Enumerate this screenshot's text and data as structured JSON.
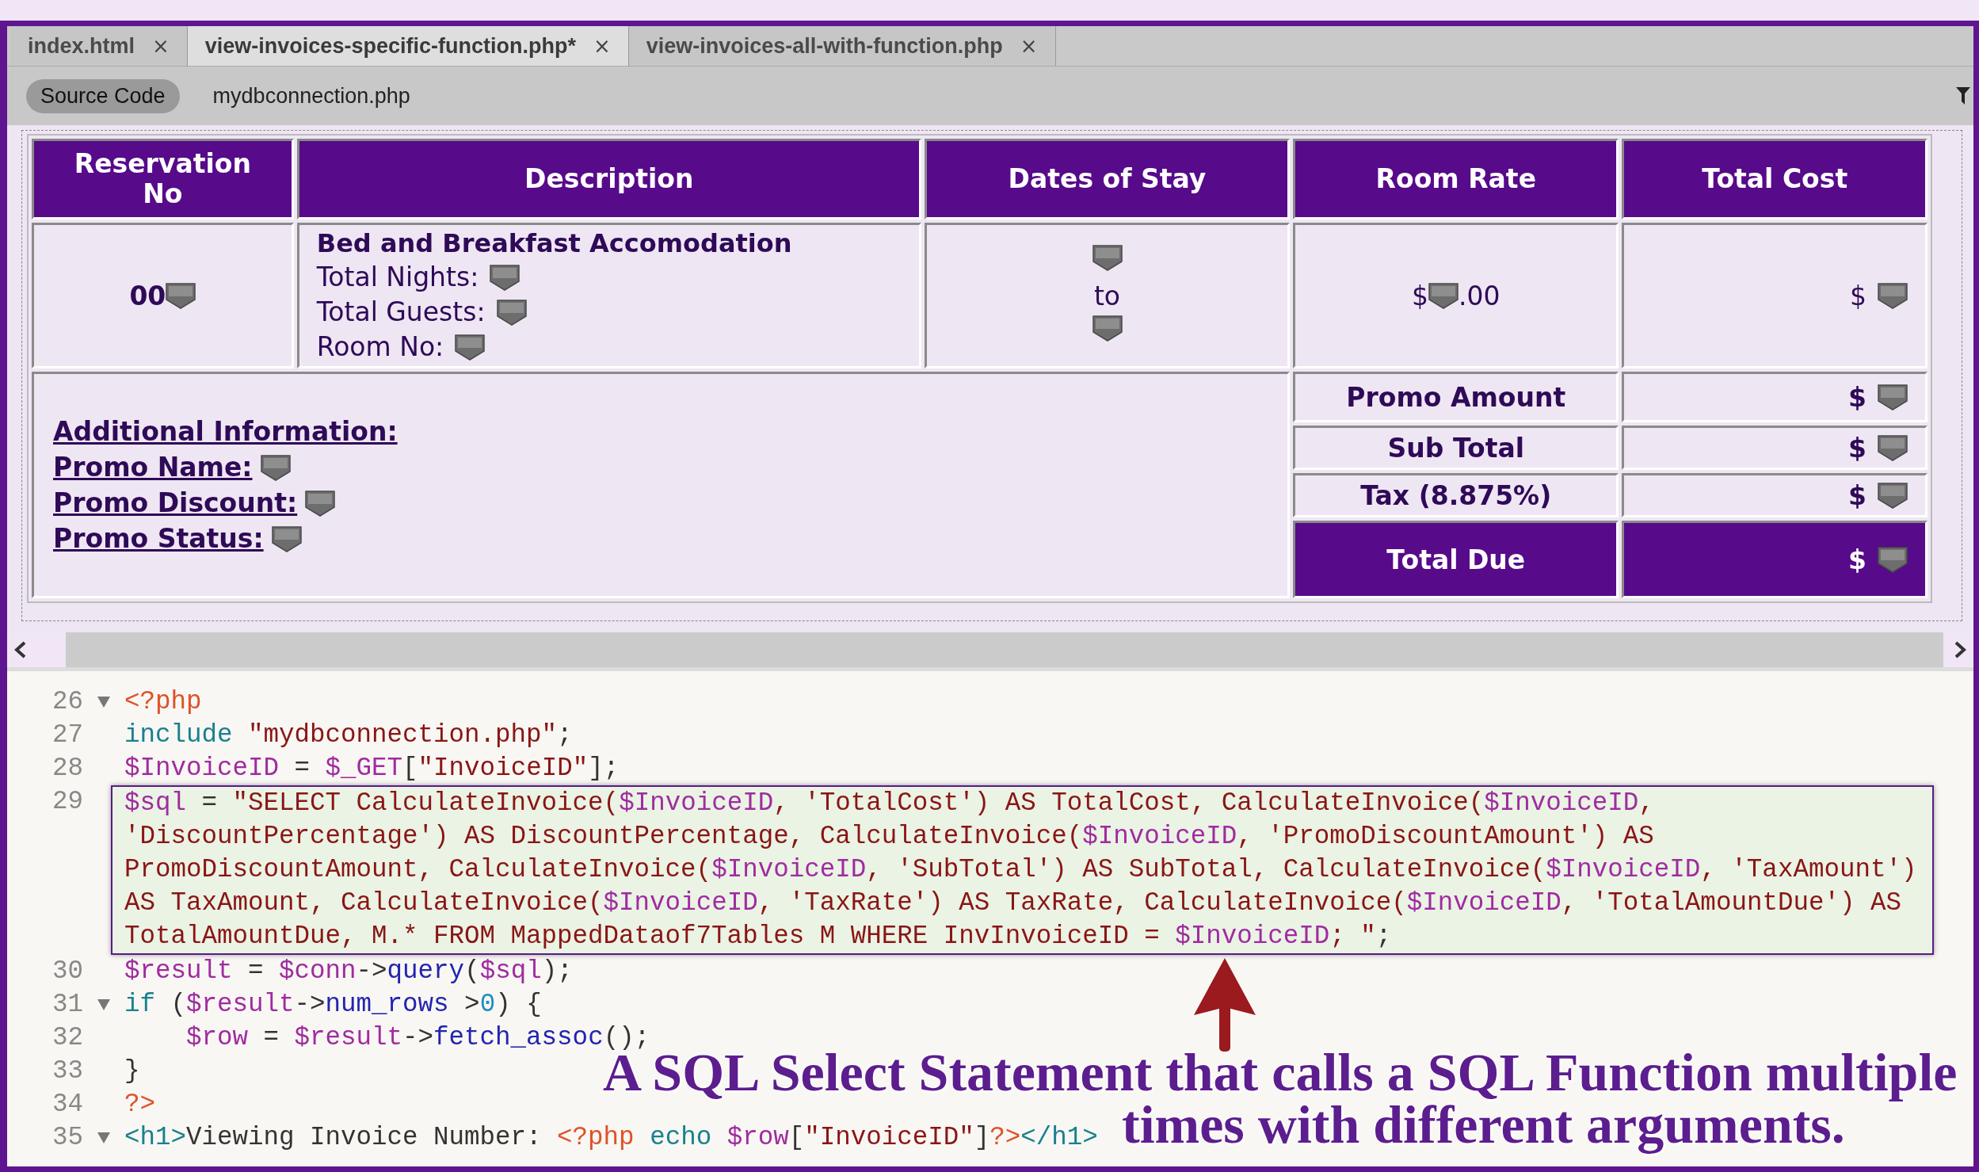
{
  "tabs": [
    {
      "label": "index.html",
      "close": "×",
      "selected": false
    },
    {
      "label": "view-invoices-specific-function.php*",
      "close": "×",
      "selected": true
    },
    {
      "label": "view-invoices-all-with-function.php",
      "close": "×",
      "selected": false
    }
  ],
  "related_files": [
    {
      "label": "Source Code",
      "selected": true
    },
    {
      "label": "mydbconnection.php",
      "selected": false
    }
  ],
  "invoice": {
    "columns": [
      "Reservation No",
      "Description",
      "Dates of Stay",
      "Room Rate",
      "Total Cost"
    ],
    "reservation_no": "00",
    "description_title": "Bed and Breakfast Accomodation",
    "description_lines": [
      "Total Nights:",
      "Total Guests:",
      "Room No:"
    ],
    "dates_separator": "to",
    "room_rate_prefix": "$",
    "room_rate_suffix": ".00",
    "total_cost_prefix": "$",
    "additional_heading": "Additional Information:",
    "additional_items": [
      "Promo Name:",
      "Promo Discount:",
      "Promo Status:"
    ],
    "summary": [
      {
        "label": "Promo Amount",
        "value": "$",
        "kind": "normal"
      },
      {
        "label": "Sub Total",
        "value": "$",
        "kind": "normal"
      },
      {
        "label": "Tax (8.875%)",
        "value": "$",
        "kind": "normal"
      },
      {
        "label": "Total Due",
        "value": "$",
        "kind": "total"
      }
    ]
  },
  "code": [
    {
      "number": "26",
      "foldable": true,
      "visual_lines": [
        {
          "tokens": [
            {
              "kind": "php",
              "text": "<?php"
            }
          ]
        }
      ]
    },
    {
      "number": "27",
      "foldable": false,
      "visual_lines": [
        {
          "tokens": [
            {
              "kind": "kw",
              "text": "include "
            },
            {
              "kind": "str",
              "text": "\"mydbconnection.php\""
            },
            {
              "kind": "plain",
              "text": ";"
            }
          ]
        }
      ]
    },
    {
      "number": "28",
      "foldable": false,
      "visual_lines": [
        {
          "tokens": [
            {
              "kind": "var",
              "text": "$InvoiceID"
            },
            {
              "kind": "plain",
              "text": " = "
            },
            {
              "kind": "var",
              "text": "$_GET"
            },
            {
              "kind": "plain",
              "text": "["
            },
            {
              "kind": "str",
              "text": "\"InvoiceID\""
            },
            {
              "kind": "plain",
              "text": "];"
            }
          ]
        }
      ]
    },
    {
      "number": "29",
      "foldable": false,
      "highlighted": true,
      "visual_lines": [
        {
          "tokens": [
            {
              "kind": "var",
              "text": "$sql"
            },
            {
              "kind": "plain",
              "text": " = "
            },
            {
              "kind": "str",
              "text": "\"SELECT CalculateInvoice("
            },
            {
              "kind": "var",
              "text": "$InvoiceID"
            },
            {
              "kind": "str",
              "text": ", 'TotalCost') AS TotalCost, CalculateInvoice("
            },
            {
              "kind": "var",
              "text": "$InvoiceID"
            },
            {
              "kind": "str",
              "text": ","
            }
          ]
        },
        {
          "tokens": [
            {
              "kind": "str",
              "text": "'DiscountPercentage') AS DiscountPercentage, CalculateInvoice("
            },
            {
              "kind": "var",
              "text": "$InvoiceID"
            },
            {
              "kind": "str",
              "text": ", 'PromoDiscountAmount') AS"
            }
          ]
        },
        {
          "tokens": [
            {
              "kind": "str",
              "text": "PromoDiscountAmount, CalculateInvoice("
            },
            {
              "kind": "var",
              "text": "$InvoiceID"
            },
            {
              "kind": "str",
              "text": ", 'SubTotal') AS SubTotal, CalculateInvoice("
            },
            {
              "kind": "var",
              "text": "$InvoiceID"
            },
            {
              "kind": "str",
              "text": ", 'TaxAmount')"
            }
          ]
        },
        {
          "tokens": [
            {
              "kind": "str",
              "text": "AS TaxAmount, CalculateInvoice("
            },
            {
              "kind": "var",
              "text": "$InvoiceID"
            },
            {
              "kind": "str",
              "text": ", 'TaxRate') AS TaxRate, CalculateInvoice("
            },
            {
              "kind": "var",
              "text": "$InvoiceID"
            },
            {
              "kind": "str",
              "text": ", 'TotalAmountDue') AS"
            }
          ]
        },
        {
          "tokens": [
            {
              "kind": "str",
              "text": "TotalAmountDue, M.* FROM MappedDataof7Tables M WHERE InvInvoiceID = "
            },
            {
              "kind": "var",
              "text": "$InvoiceID"
            },
            {
              "kind": "str",
              "text": "; \""
            },
            {
              "kind": "plain",
              "text": ";"
            }
          ]
        }
      ]
    },
    {
      "number": "30",
      "foldable": false,
      "visual_lines": [
        {
          "tokens": [
            {
              "kind": "var",
              "text": "$result"
            },
            {
              "kind": "plain",
              "text": " = "
            },
            {
              "kind": "var",
              "text": "$conn"
            },
            {
              "kind": "plain",
              "text": "->"
            },
            {
              "kind": "func",
              "text": "query"
            },
            {
              "kind": "plain",
              "text": "("
            },
            {
              "kind": "var",
              "text": "$sql"
            },
            {
              "kind": "plain",
              "text": ");"
            }
          ]
        }
      ]
    },
    {
      "number": "31",
      "foldable": true,
      "visual_lines": [
        {
          "tokens": [
            {
              "kind": "kw",
              "text": "if"
            },
            {
              "kind": "plain",
              "text": " ("
            },
            {
              "kind": "var",
              "text": "$result"
            },
            {
              "kind": "plain",
              "text": "->"
            },
            {
              "kind": "func",
              "text": "num_rows"
            },
            {
              "kind": "plain",
              "text": " >"
            },
            {
              "kind": "num",
              "text": "0"
            },
            {
              "kind": "plain",
              "text": ") {"
            }
          ]
        }
      ]
    },
    {
      "number": "32",
      "foldable": false,
      "visual_lines": [
        {
          "tokens": [
            {
              "kind": "var",
              "text": "    $row"
            },
            {
              "kind": "plain",
              "text": " = "
            },
            {
              "kind": "var",
              "text": "$result"
            },
            {
              "kind": "plain",
              "text": "->"
            },
            {
              "kind": "func",
              "text": "fetch_assoc"
            },
            {
              "kind": "plain",
              "text": "();"
            }
          ]
        }
      ]
    },
    {
      "number": "33",
      "foldable": false,
      "visual_lines": [
        {
          "tokens": [
            {
              "kind": "plain",
              "text": "}"
            }
          ]
        }
      ]
    },
    {
      "number": "34",
      "foldable": false,
      "visual_lines": [
        {
          "tokens": [
            {
              "kind": "php",
              "text": "?>"
            }
          ]
        }
      ]
    },
    {
      "number": "35",
      "foldable": true,
      "visual_lines": [
        {
          "tokens": [
            {
              "kind": "tag",
              "text": "<h1>"
            },
            {
              "kind": "plain",
              "text": "Viewing Invoice Number: "
            },
            {
              "kind": "php",
              "text": "<?php "
            },
            {
              "kind": "kw",
              "text": "echo "
            },
            {
              "kind": "var",
              "text": "$row"
            },
            {
              "kind": "plain",
              "text": "["
            },
            {
              "kind": "str",
              "text": "\"InvoiceID\""
            },
            {
              "kind": "plain",
              "text": "]"
            },
            {
              "kind": "php",
              "text": "?>"
            },
            {
              "kind": "tag",
              "text": "</h1>"
            }
          ]
        }
      ]
    }
  ],
  "annotation": {
    "lines": [
      "A SQL Select Statement that calls a SQL Function multiple",
      "times with different arguments."
    ]
  }
}
